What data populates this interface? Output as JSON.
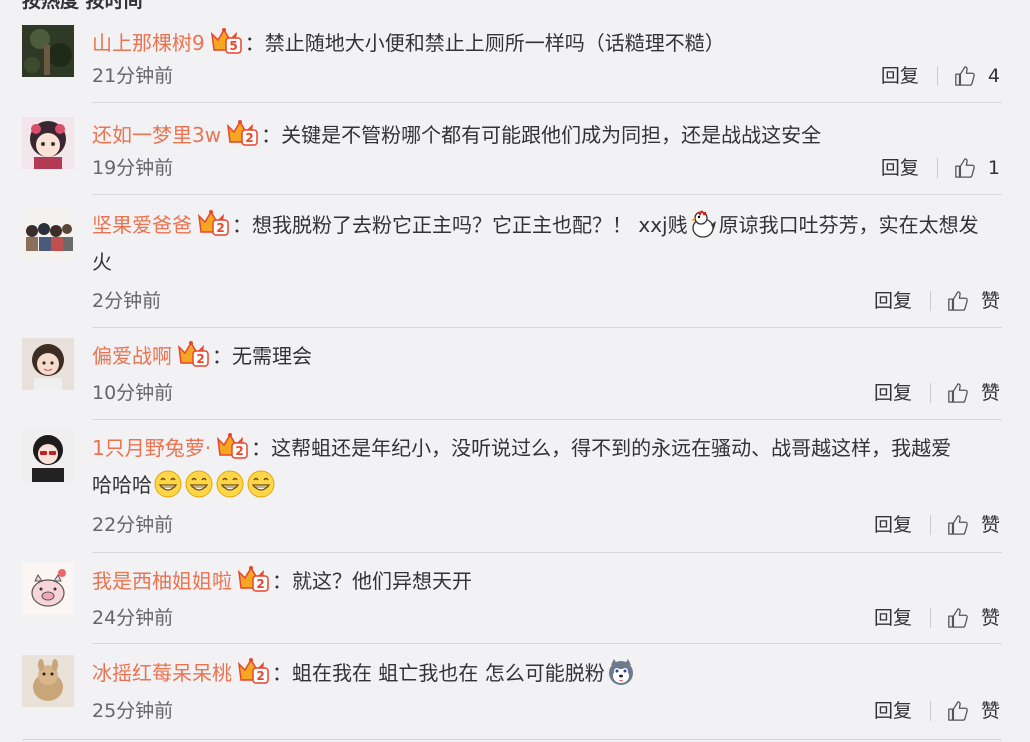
{
  "header_cut": "按热度  按时间",
  "comments": [
    {
      "user": "山上那棵树9",
      "text": "禁止随地大小便和禁止上厕所一样吗（话糙理不糙）",
      "line2": "",
      "time": "21分钟前",
      "reply": "回复",
      "likes": "4",
      "badge": "5"
    },
    {
      "user": "还如一梦里3w",
      "text": "关键是不管粉哪个都有可能跟他们成为同担，还是战战这安全",
      "line2": "",
      "time": "19分钟前",
      "reply": "回复",
      "likes": "1",
      "badge": "2"
    },
    {
      "user": "坚果爱爸爸",
      "text": "想我脱粉了去粉它正主吗？它正主也配？！ xxj贱",
      "text_b": "原谅我口吐芬芳，实在太想发",
      "line2": "火",
      "time": "2分钟前",
      "reply": "回复",
      "likes": "赞",
      "badge": "2"
    },
    {
      "user": "偏爱战啊",
      "text": "无需理会",
      "line2": "",
      "time": "10分钟前",
      "reply": "回复",
      "likes": "赞",
      "badge": "2"
    },
    {
      "user": "1只月野兔萝·",
      "text": "这帮蛆还是年纪小，没听说过么，得不到的永远在骚动、战哥越这样，我越爱",
      "line2": "哈哈哈",
      "time": "22分钟前",
      "reply": "回复",
      "likes": "赞",
      "badge": "2"
    },
    {
      "user": "我是西柚姐姐啦",
      "text": "就这？他们异想天开",
      "line2": "",
      "time": "24分钟前",
      "reply": "回复",
      "likes": "赞",
      "badge": "2"
    },
    {
      "user": "冰摇红莓呆呆桃",
      "text": "蛆在我在 蛆亡我也在  怎么可能脱粉",
      "line2": "",
      "time": "25分钟前",
      "reply": "回复",
      "likes": "赞",
      "badge": "2"
    }
  ],
  "colors": {
    "username": "#eb7350",
    "text": "#333333",
    "timestamp": "#666666",
    "background": "#f2f2f5",
    "divider": "#d9d9d9",
    "crown": "#f5a623",
    "badge_red": "#e8452c"
  },
  "icons": {
    "vip": "vip-crown-badge-icon",
    "like": "thumbs-up-icon",
    "emoji_grin": "grin-emoji-icon",
    "emoji_husky": "husky-emoji-icon",
    "emoji_chicken": "chicken-emoji-icon"
  }
}
